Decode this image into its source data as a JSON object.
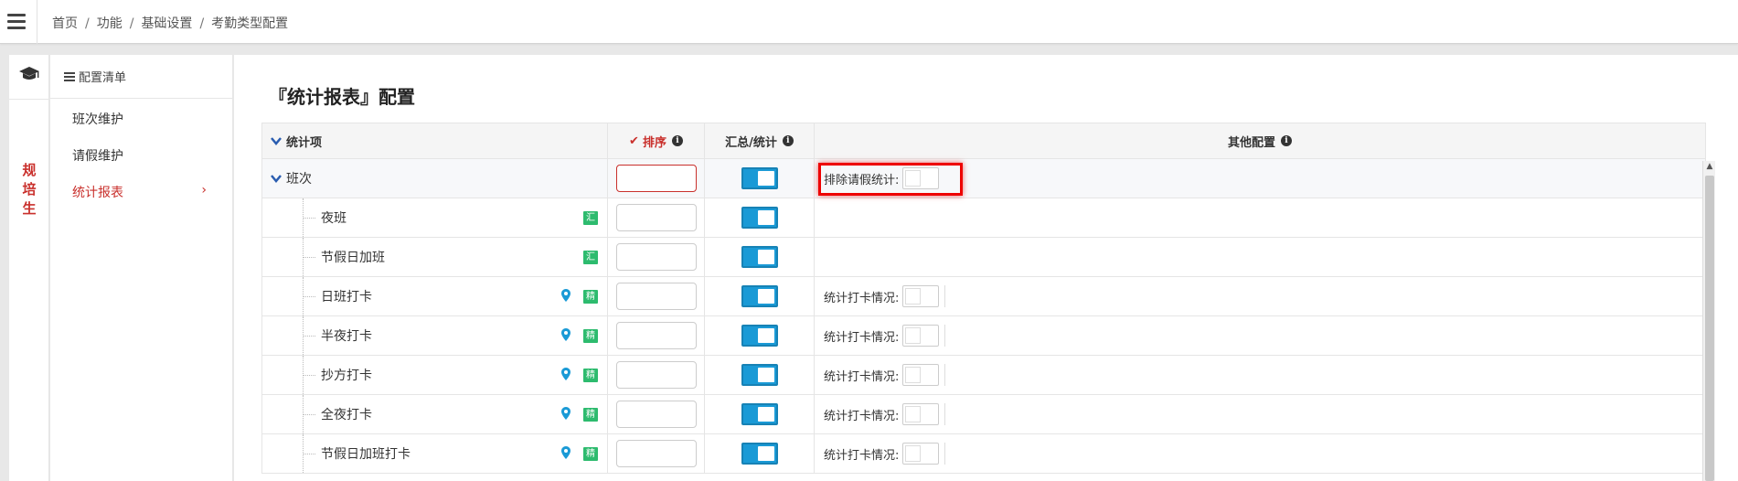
{
  "breadcrumb": [
    "首页",
    "功能",
    "基础设置",
    "考勤类型配置"
  ],
  "sidebar": {
    "vertical_label": [
      "规",
      "培",
      "生"
    ],
    "config_list_title": "配置清单",
    "items": [
      {
        "label": "班次维护"
      },
      {
        "label": "请假维护"
      },
      {
        "label": "统计报表"
      }
    ],
    "active_chevron": "›"
  },
  "page_title": "『统计报表』配置",
  "table": {
    "headers": {
      "item": "统计项",
      "sort": "排序",
      "summary": "汇总/统计",
      "other": "其他配置"
    },
    "group": {
      "label": "班次",
      "sort_value": "",
      "summary_on": true,
      "other_label": "排除请假统计:"
    },
    "rows": [
      {
        "label": "夜班",
        "badge": "汇",
        "pin": false,
        "other_label": ""
      },
      {
        "label": "节假日加班",
        "badge": "汇",
        "pin": false,
        "other_label": ""
      },
      {
        "label": "日班打卡",
        "badge": "精",
        "pin": true,
        "other_label": "统计打卡情况:"
      },
      {
        "label": "半夜打卡",
        "badge": "精",
        "pin": true,
        "other_label": "统计打卡情况:"
      },
      {
        "label": "抄方打卡",
        "badge": "精",
        "pin": true,
        "other_label": "统计打卡情况:"
      },
      {
        "label": "全夜打卡",
        "badge": "精",
        "pin": true,
        "other_label": "统计打卡情况:"
      },
      {
        "label": "节假日加班打卡",
        "badge": "精",
        "pin": true,
        "other_label": "统计打卡情况:"
      }
    ]
  },
  "colors": {
    "accent_red": "#c9302c",
    "switch_blue": "#1a9ad6",
    "badge_green": "#2dbb6e"
  }
}
